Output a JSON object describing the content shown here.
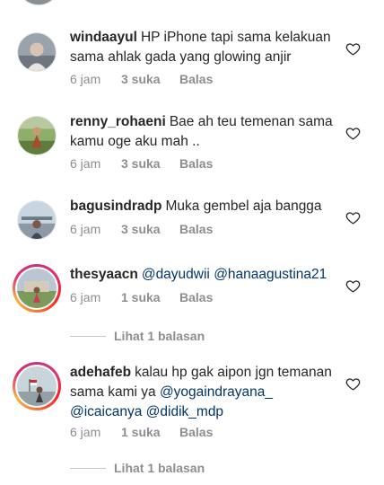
{
  "comments": [
    {
      "username": "windaayul",
      "text": "HP iPhone tapi  sama kelakuan sama ahlak gada yang glowing anjir",
      "time": "6 jam",
      "likes": "3 suka",
      "reply": "Balas"
    },
    {
      "username": "renny_rohaeni",
      "text": "Bae ah teu temenan sama kamu oge aku mah ..",
      "time": "6 jam",
      "likes": "3 suka",
      "reply": "Balas"
    },
    {
      "username": "bagusindradp",
      "text": "Muka gembel aja bangga",
      "time": "6 jam",
      "likes": "3 suka",
      "reply": "Balas"
    },
    {
      "username": "thesyaacn",
      "mention1": "@dayudwii",
      "mention2": "@hanaagustina21",
      "time": "6 jam",
      "likes": "1 suka",
      "reply": "Balas",
      "view_replies": "Lihat 1 balasan"
    },
    {
      "username": "adehafeb",
      "text": "kalau hp gak aipon jgn temanan sama kami ya",
      "mention1": "@yogaindrayana_",
      "mention2": "@icaicanya",
      "mention3": "@didik_mdp",
      "time": "6 jam",
      "likes": "1 suka",
      "reply": "Balas",
      "view_replies": "Lihat 1 balasan"
    }
  ],
  "colors": {
    "text": "#262626",
    "meta": "#8e8e8e",
    "mention": "#003569"
  },
  "icons": {
    "like": "heart-outline-icon"
  }
}
